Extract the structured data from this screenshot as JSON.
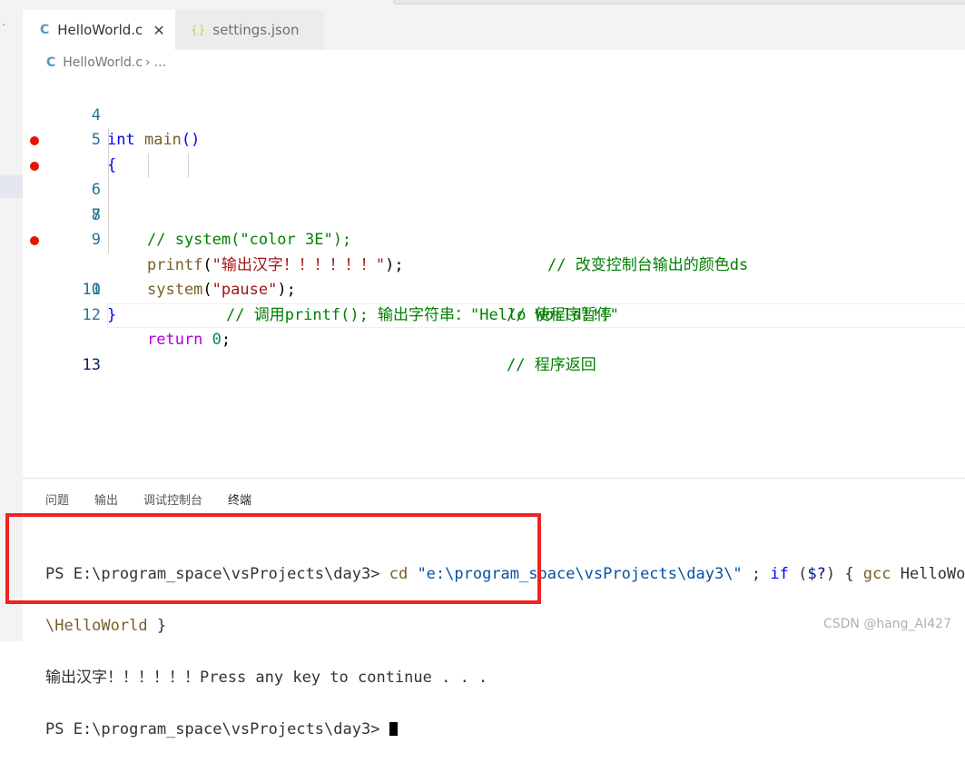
{
  "tabs": [
    {
      "label": "HelloWorld.c",
      "icon": "C",
      "close": "✕",
      "active": true
    },
    {
      "label": "settings.json",
      "icon": "{}",
      "active": false
    }
  ],
  "breadcrumb": {
    "icon": "C",
    "file": "HelloWorld.c",
    "separator": "›",
    "rest": "..."
  },
  "editor": {
    "lines": [
      {
        "num": "4"
      },
      {
        "num": "5"
      },
      {
        "num": "6",
        "breakpoint": true
      },
      {
        "num": "7",
        "breakpoint": true
      },
      {
        "num": "8"
      },
      {
        "num": "9"
      },
      {
        "num": "10",
        "breakpoint": true
      },
      {
        "num": "11"
      },
      {
        "num": "12"
      },
      {
        "num": "13"
      }
    ],
    "code": {
      "l4_kw": "int",
      "l4_fn": "main",
      "l4_rest": "()",
      "l5": "{",
      "l6_code": "// system(\"color 3E\");",
      "l6_comment": "// 改变控制台输出的颜色ds",
      "l7_comment": "// 调用printf(); 输出字符串：\"Hello World!!!\"",
      "l8_fn": "printf",
      "l8_open": "(",
      "l8_str": "\"输出汉字！！！！！！\"",
      "l8_close": ");",
      "l9_fn": "system",
      "l9_open": "(",
      "l9_str": "\"pause\"",
      "l9_close": ");",
      "l9_comment": "// 使程序暂停",
      "l10_kw": "return",
      "l10_num": "0",
      "l10_semi": ";",
      "l10_comment": "// 程序返回",
      "l11": "}"
    }
  },
  "panel": {
    "tabs": [
      "问题",
      "输出",
      "调试控制台",
      "终端"
    ],
    "active_tab": "终端"
  },
  "terminal": {
    "line1_prompt": "PS E:\\program_space\\vsProjects\\day3> ",
    "line1_cd": "cd",
    "line1_path": "\"e:\\program_space\\vsProjects\\day3\\\"",
    "line1_semi": " ; ",
    "line1_if": "if",
    "line1_cond_open": " (",
    "line1_var": "$?",
    "line1_cond_close": ") { ",
    "line1_gcc": "gcc",
    "line1_tail": " HelloWorld",
    "line2": "\\HelloWorld",
    "line2_tail": " }",
    "line3": "输出汉字！！！！！！Press any key to continue . . .",
    "line4_prompt": "PS E:\\program_space\\vsProjects\\day3> "
  },
  "watermark": "CSDN @hang_AI427",
  "colors": {
    "highlight_box": "#f02222",
    "breakpoint": "#e51400",
    "line_number": "#237893"
  }
}
